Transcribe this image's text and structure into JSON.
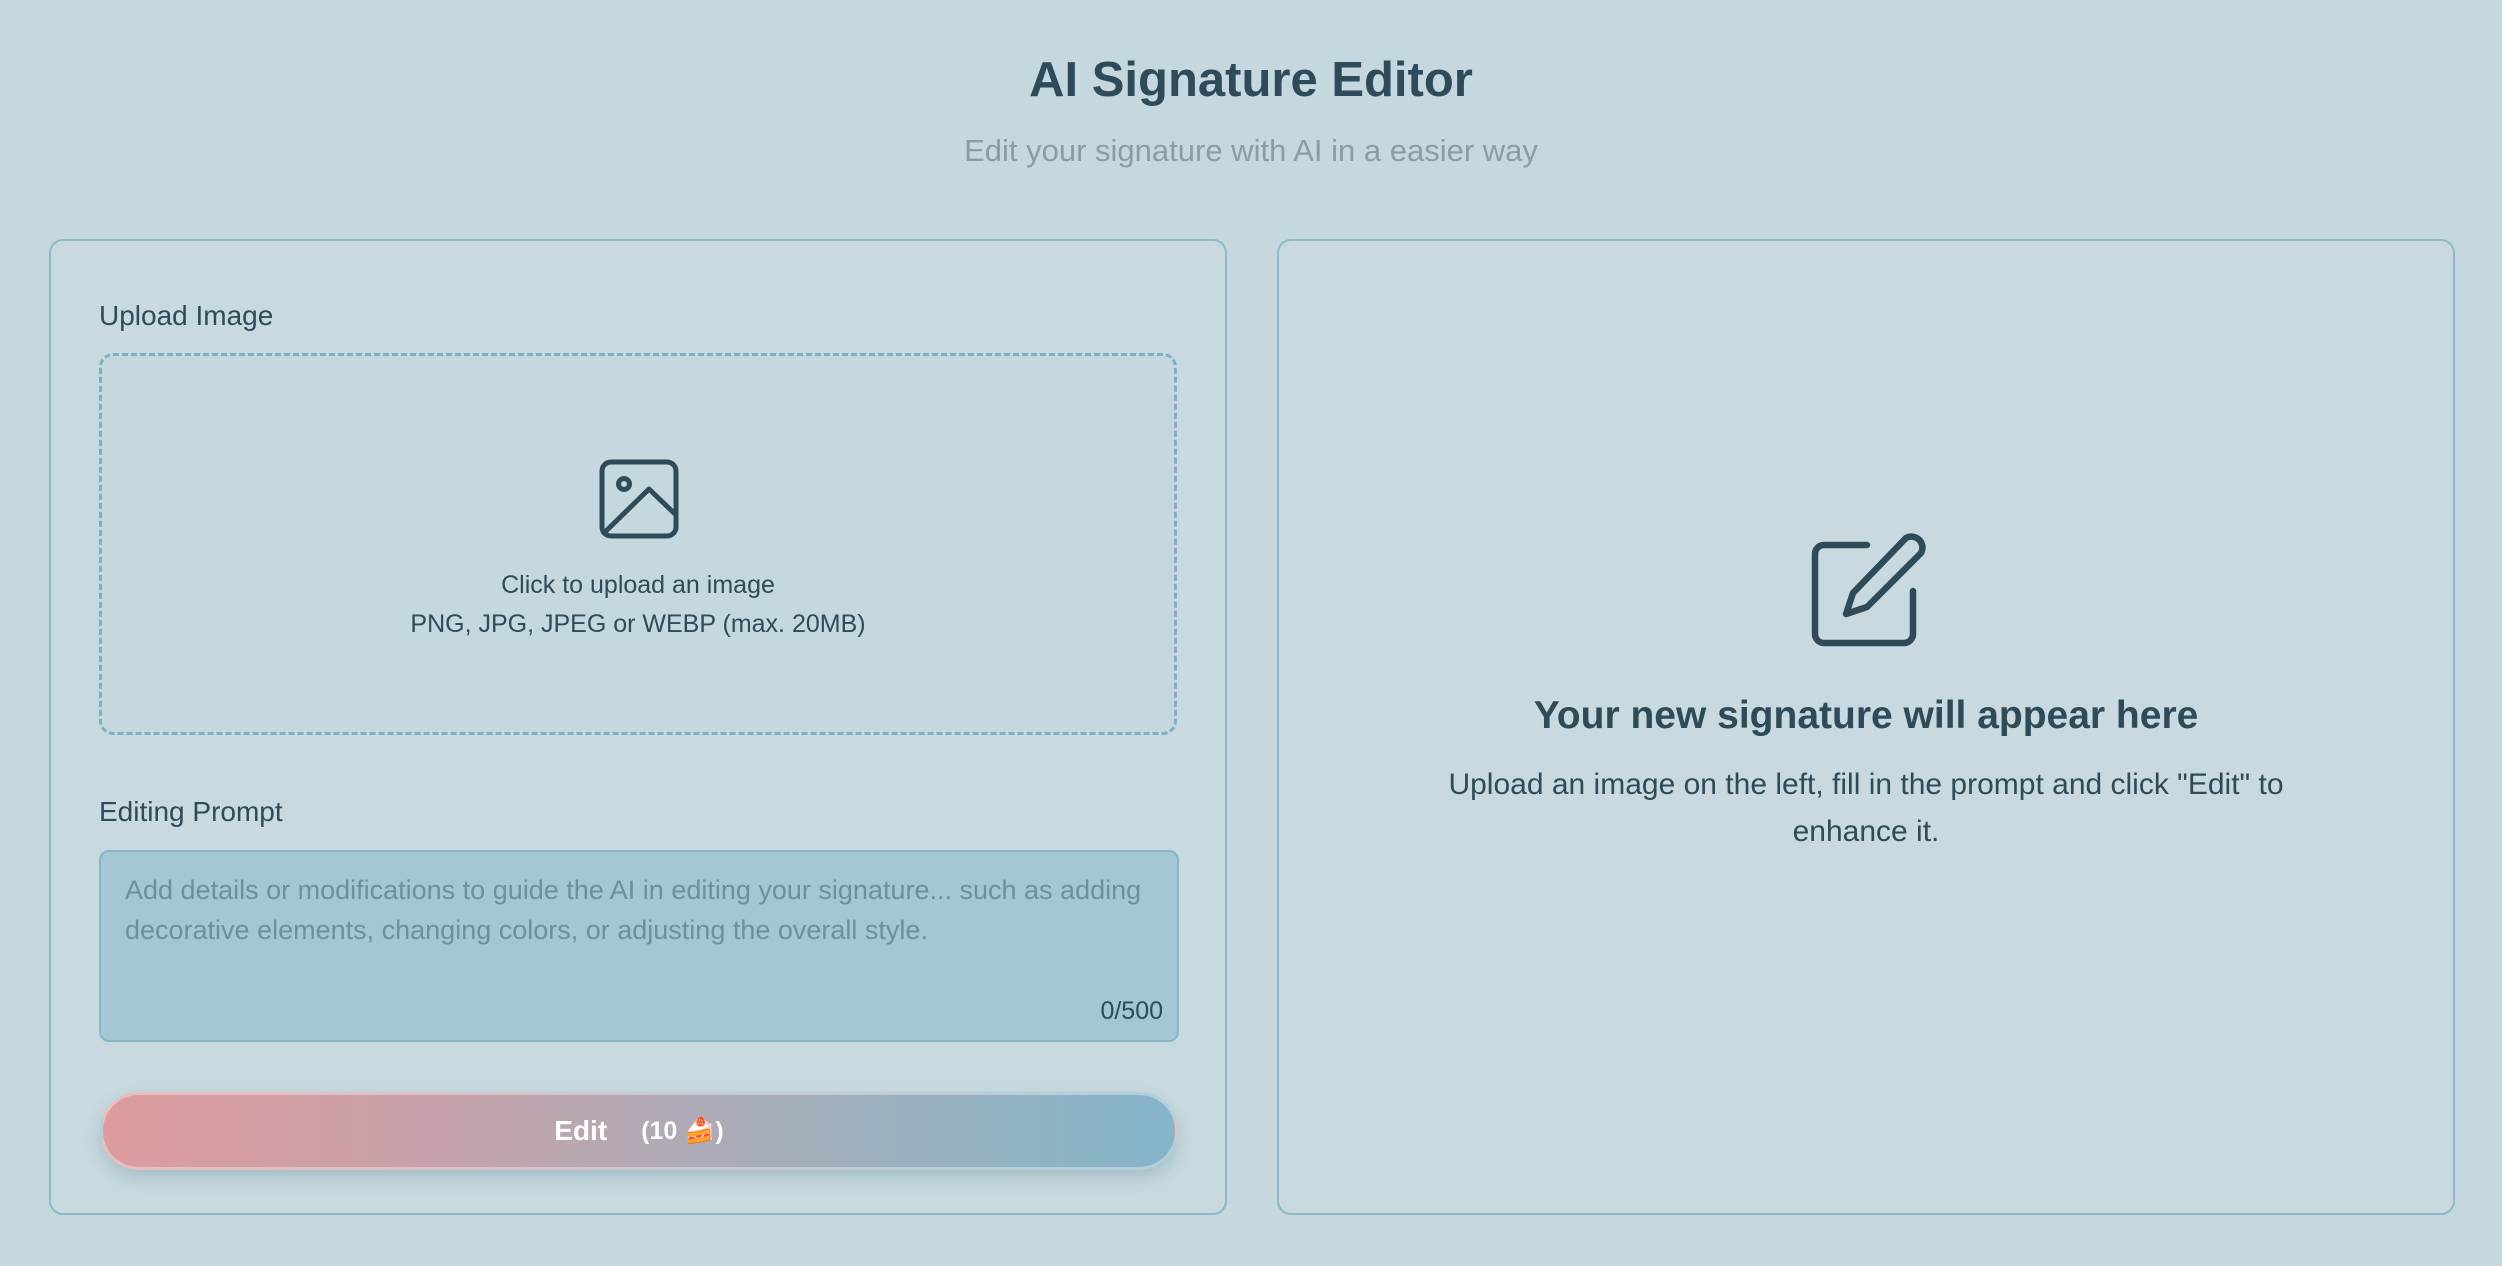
{
  "header": {
    "title": "AI Signature Editor",
    "subtitle": "Edit your signature with AI in a easier way"
  },
  "upload": {
    "label": "Upload Image",
    "icon": "image-icon",
    "primary_text": "Click to upload an image",
    "secondary_text": "PNG, JPG, JPEG or WEBP (max. 20MB)"
  },
  "prompt": {
    "label": "Editing Prompt",
    "value": "",
    "placeholder": "Add details or modifications to guide the AI in editing your signature... such as adding decorative elements, changing colors, or adjusting the overall style.",
    "counter": "0/500"
  },
  "edit_button": {
    "label": "Edit",
    "cost": "(10 🍰)"
  },
  "result": {
    "icon": "edit-icon",
    "title": "Your new signature will appear here",
    "description": "Upload an image on the left, fill in the prompt and click \"Edit\" to enhance it."
  },
  "colors": {
    "background": "#c6d8df",
    "panel_border": "#8cb8c8",
    "text": "#2f4a59",
    "subtitle": "#8c9ba5",
    "prompt_background": "#a5c7d3",
    "button_gradient_start": "#dd9c9e",
    "button_gradient_end": "#84b5c9"
  }
}
